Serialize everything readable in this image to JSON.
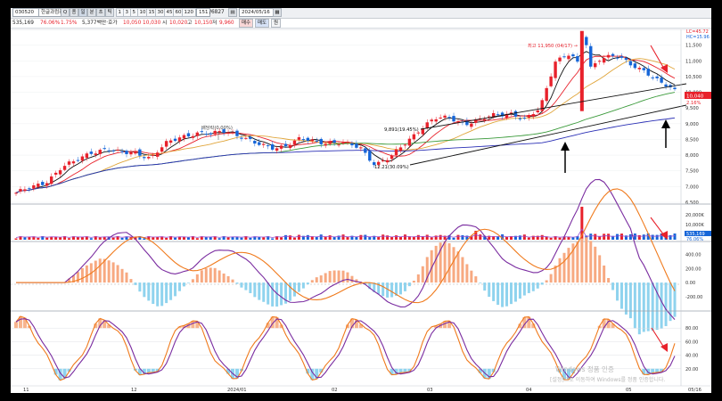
{
  "toolbar": {
    "code": "030520",
    "stock_name": "한글과컴퓨터",
    "tools": [
      "Q",
      "종",
      "일",
      "분",
      "초",
      "틱"
    ],
    "periods": [
      "1",
      "3",
      "5",
      "10",
      "15",
      "30",
      "45",
      "60",
      "120"
    ],
    "count": "151",
    "total": "/6827",
    "date": "2024/05/16"
  },
  "quote": {
    "volume_field": "535,169",
    "vol_ratio": "76.06%",
    "rate": "1.75%",
    "amount_label": "5,377백만·호가",
    "price1": "10,050",
    "price2": "10,030",
    "open_label": "시",
    "open": "10,020",
    "high_label": "고",
    "high": "10,150",
    "low_label": "저",
    "low": "9,960",
    "btn_sell": "매수",
    "btn_buy": "매도",
    "btn_reset": "원"
  },
  "chart_data": [
    {
      "type": "candlestick",
      "panel": "price",
      "y_axis_ticks": [
        "11,500",
        "11,000",
        "10,500",
        "10,000",
        "9,500",
        "9,000",
        "8,500",
        "8,000",
        "7,500",
        "7,000",
        "6,500"
      ],
      "ylim": [
        6500,
        12000
      ],
      "x_tick_labels": [
        "11",
        "12",
        "2024/01",
        "02",
        "03",
        "04",
        "05",
        "05/16"
      ],
      "annotations": {
        "high_marker": "최고 11,950 (04/17) →",
        "dividend": "배당락(0.00%)",
        "level_upper": "9,891(19.45%)",
        "level_lower": "12.21(30.09%)"
      },
      "right_labels": {
        "lc": "LC=45.72",
        "hc": "HC=15.96",
        "last_price": "10,040",
        "change": "2.16%"
      },
      "series": [
        {
          "name": "close_approx",
          "values": [
            6800,
            6950,
            7150,
            7600,
            7800,
            8100,
            8200,
            8050,
            8100,
            7900,
            8350,
            8600,
            8700,
            8650,
            8800,
            8600,
            8350,
            8250,
            8300,
            8500,
            8450,
            8400,
            8350,
            8250,
            7700,
            7900,
            8400,
            8850,
            9150,
            9200,
            9000,
            9100,
            9300,
            9350,
            9100,
            9500,
            11000,
            11200,
            10600,
            11100,
            11150,
            10900,
            10700,
            10300,
            10040
          ]
        }
      ]
    },
    {
      "type": "bar",
      "panel": "volume",
      "y_axis_ticks": [
        "20,000K",
        "10,000K"
      ],
      "right_labels": {
        "volume": "535,169",
        "ratio": "76.06%"
      }
    },
    {
      "type": "line",
      "panel": "macd",
      "y_axis_ticks": [
        "400.00",
        "200.00",
        "0.00",
        "-200.00"
      ],
      "ylim": [
        -380,
        560
      ]
    },
    {
      "type": "line",
      "panel": "stochastic",
      "y_axis_ticks": [
        "80.00",
        "60.00",
        "40.00",
        "20.00"
      ],
      "ylim": [
        0,
        100
      ]
    }
  ],
  "watermark": {
    "line1": "Windows 정품 인증",
    "line2": "[설정]으로 이동하여 Windows를 정품 인증합니다."
  },
  "colors": {
    "up": "#e8212b",
    "down": "#1565d8",
    "ma5": "#111111",
    "ma10": "#e8212b",
    "ma20": "#e0a53a",
    "ma60": "#3a9a3a",
    "ma120": "#2a2fb5",
    "macd_line": "#7a2ca0",
    "signal_line": "#f07a1c",
    "macd_pos": "#f7a981",
    "macd_neg": "#8fd3ee"
  }
}
